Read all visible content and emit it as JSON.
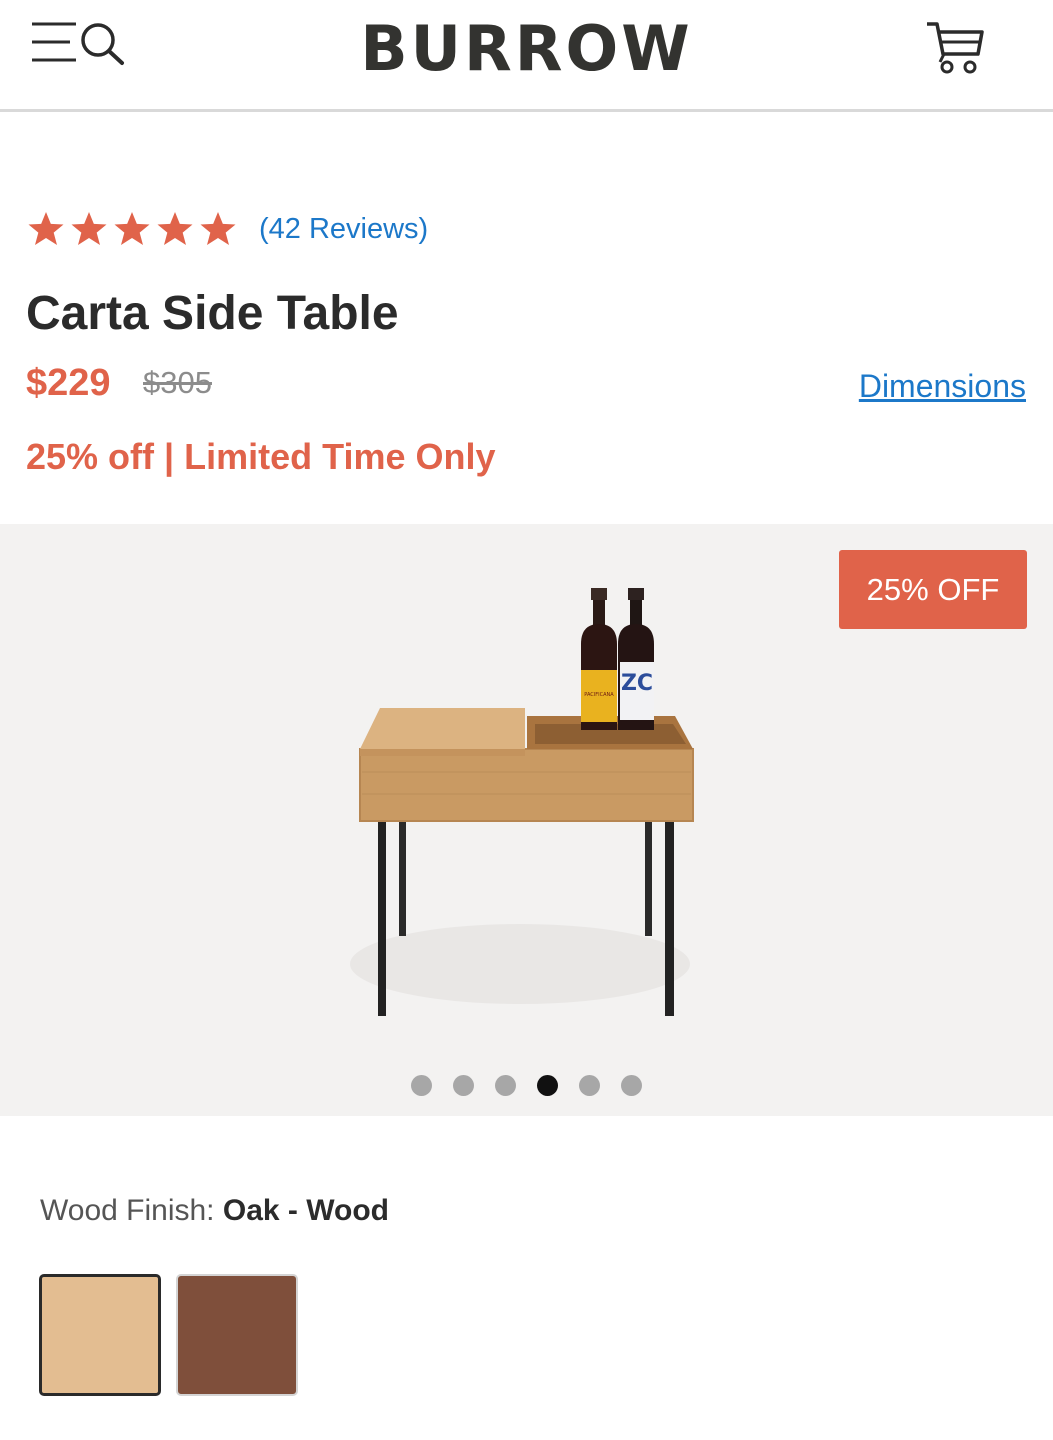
{
  "header": {
    "logo": "BURROW",
    "icons": [
      "menu-icon",
      "search-icon",
      "cart-icon"
    ]
  },
  "rating": {
    "stars": 5,
    "reviews_label": "(42 Reviews)"
  },
  "product": {
    "title": "Carta Side Table",
    "price": "$229",
    "original_price": "$305",
    "dimensions_link": "Dimensions",
    "promo": "25% off | Limited Time Only"
  },
  "gallery": {
    "badge": "25% OFF",
    "total_images": 6,
    "active_index": 3
  },
  "finish": {
    "label": "Wood Finish:",
    "selected": "Oak - Wood",
    "swatches": [
      {
        "name": "oak",
        "color": "#e3bd91",
        "selected": true
      },
      {
        "name": "walnut",
        "color": "#7f4f3b",
        "selected": false
      }
    ]
  },
  "colors": {
    "accent": "#e0634a",
    "link": "#1c78c9",
    "text": "#2b2b2b"
  }
}
